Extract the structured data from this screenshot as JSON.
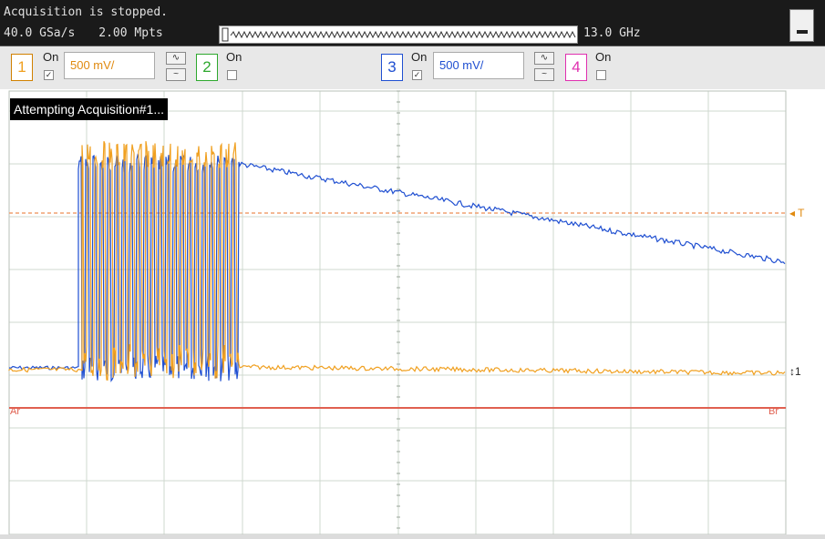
{
  "status": {
    "acquisition": "Acquisition is stopped.",
    "sample_rate": "40.0 GSa/s",
    "memory_depth": "2.00 Mpts",
    "bandwidth": "13.0 GHz"
  },
  "channels": [
    {
      "number": "1",
      "on_label": "On",
      "checked": true,
      "scale": "500 mV/",
      "color": "#f0a020"
    },
    {
      "number": "2",
      "on_label": "On",
      "checked": false,
      "color": "#2ea82e"
    },
    {
      "number": "3",
      "on_label": "On",
      "checked": true,
      "scale": "500 mV/",
      "color": "#1f4fd1"
    },
    {
      "number": "4",
      "on_label": "On",
      "checked": false,
      "color": "#e030b0"
    }
  ],
  "screen": {
    "message": "Attempting Acquisition#1...",
    "trigger_marker": "T",
    "level_marker_right": "1",
    "marker_a": "Ar",
    "marker_b": "Br"
  },
  "colors": {
    "ch1": "#f0a020",
    "ch3": "#1f4fd1",
    "trigger_line": "#f0a070",
    "marker_line": "#e06050",
    "grid": "#c8d4c8"
  }
}
